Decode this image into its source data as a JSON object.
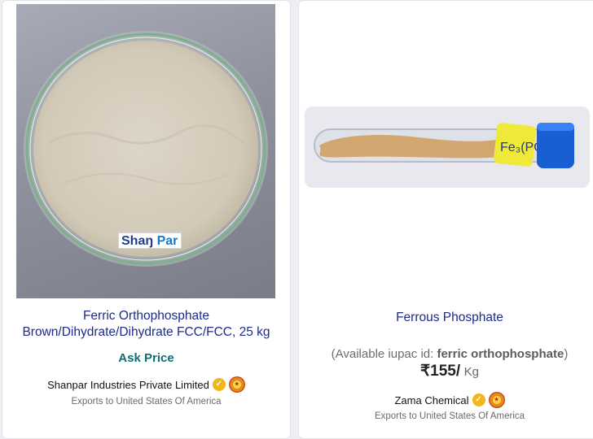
{
  "cards": [
    {
      "title_line1": "Ferric Orthophosphate",
      "title_line2": "Brown/Dihydrate/Dihydrate FCC/FCC, 25 kg",
      "price_text": "Ask Price",
      "seller": "Shanpar Industries Private Limited",
      "exports": "Exports to United States Of America",
      "image_logo": "Shan Par"
    },
    {
      "title": "Ferrous Phosphate",
      "available_prefix": "(Available iupac id: ",
      "available_name": "ferric orthophosphate",
      "available_suffix": ")",
      "price": "₹155/",
      "unit": "Kg",
      "seller": "Zama Chemical",
      "exports": "Exports to United States Of America"
    }
  ],
  "colors": {
    "title": "#1d2a8c",
    "ask_price": "#0f6e73",
    "verified_badge": "#f2b61b"
  },
  "icons": [
    "verified-badge-icon",
    "trust-seal-icon"
  ]
}
